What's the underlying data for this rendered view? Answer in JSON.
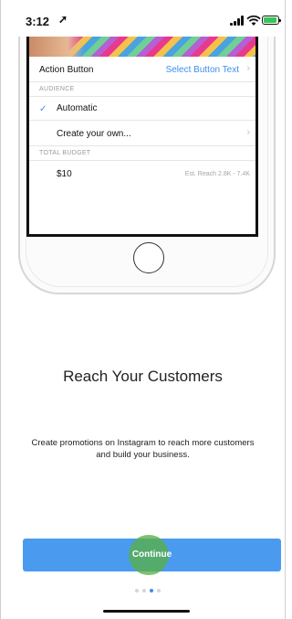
{
  "status_bar": {
    "time": "3:12",
    "location_glyph": "➚",
    "battery_charging": true,
    "battery_color": "#34c759"
  },
  "close_icon_glyph": "✕",
  "phone_screen": {
    "action_button_label": "Action Button",
    "action_button_value": "Select Button Text",
    "audience_header": "AUDIENCE",
    "audience_options": [
      {
        "label": "Automatic",
        "selected": true
      },
      {
        "label": "Create your own...",
        "selected": false
      }
    ],
    "budget_header": "TOTAL BUDGET",
    "budget_value": "$10",
    "estimated_reach": "Est. Reach 2.8K - 7.4K",
    "chevron_glyph": "›",
    "check_glyph": "✓"
  },
  "headline": "Reach Your Customers",
  "description": "Create promotions on Instagram to reach more customers and build your business.",
  "continue_button": "Continue",
  "pagination": {
    "total": 4,
    "active_index": 2
  },
  "colors": {
    "accent": "#4a9bf0",
    "link_blue": "#3f8ef0",
    "tap_highlight": "#58b046"
  }
}
